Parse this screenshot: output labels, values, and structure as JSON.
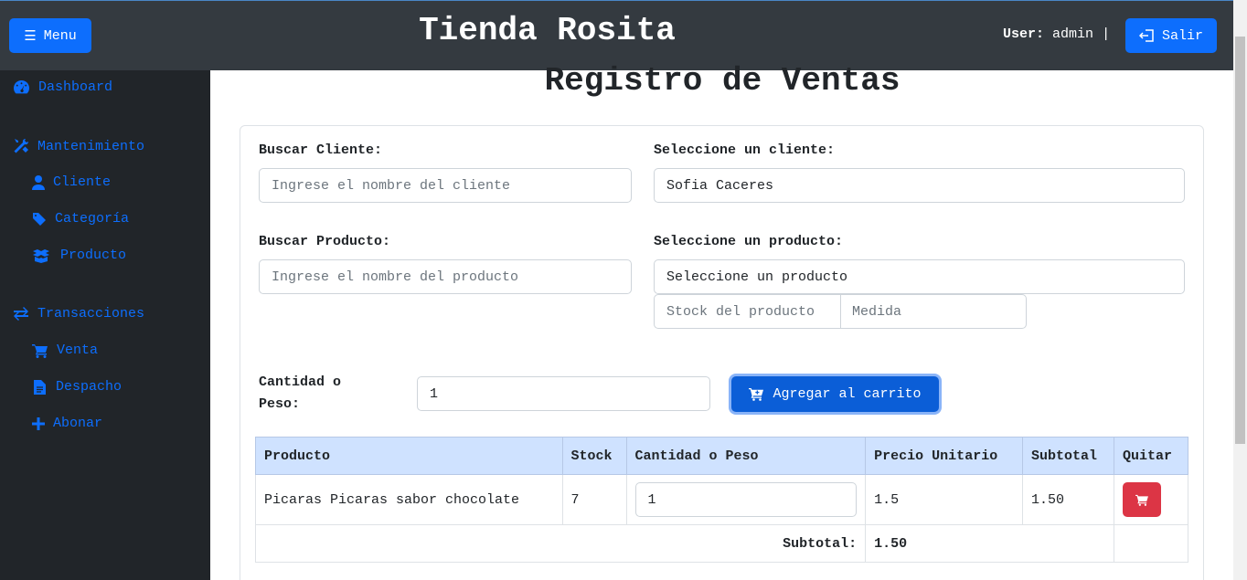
{
  "header": {
    "menu_label": "Menu",
    "title": "Tienda Rosita",
    "user_label": "User:",
    "user_name": "admin",
    "separator": "|",
    "logout_label": "Salir"
  },
  "sidebar": {
    "dashboard": "Dashboard",
    "mantenimiento": "Mantenimiento",
    "cliente": "Cliente",
    "categoria": "Categoría",
    "producto": "Producto",
    "transacciones": "Transacciones",
    "venta": "Venta",
    "despacho": "Despacho",
    "abonar": "Abonar"
  },
  "main": {
    "heading": "Registro de Ventas",
    "buscar_cliente_label": "Buscar Cliente:",
    "buscar_cliente_placeholder": "Ingrese el nombre del cliente",
    "seleccione_cliente_label": "Seleccione un cliente:",
    "cliente_selected": "Sofia Caceres",
    "buscar_producto_label": "Buscar Producto:",
    "buscar_producto_placeholder": "Ingrese el nombre del producto",
    "seleccione_producto_label": "Seleccione un producto:",
    "producto_selected": "Seleccione un producto",
    "stock_placeholder": "Stock del producto",
    "medida_placeholder": "Medida",
    "cantidad_label_1": "Cantidad o",
    "cantidad_label_2": "Peso:",
    "cantidad_value": "1",
    "add_cart_label": "Agregar al carrito"
  },
  "table": {
    "headers": [
      "Producto",
      "Stock",
      "Cantidad o Peso",
      "Precio Unitario",
      "Subtotal",
      "Quitar"
    ],
    "rows": [
      {
        "producto": "Picaras Picaras sabor chocolate",
        "stock": "7",
        "cantidad": "1",
        "precio": "1.5",
        "subtotal": "1.50"
      }
    ],
    "subtotal_label": "Subtotal:",
    "subtotal_value": "1.50"
  },
  "colors": {
    "primary": "#0d6efd",
    "danger": "#dc3545",
    "topbar": "#343a40",
    "sidebar": "#212529",
    "table_header": "#cfe2ff"
  }
}
